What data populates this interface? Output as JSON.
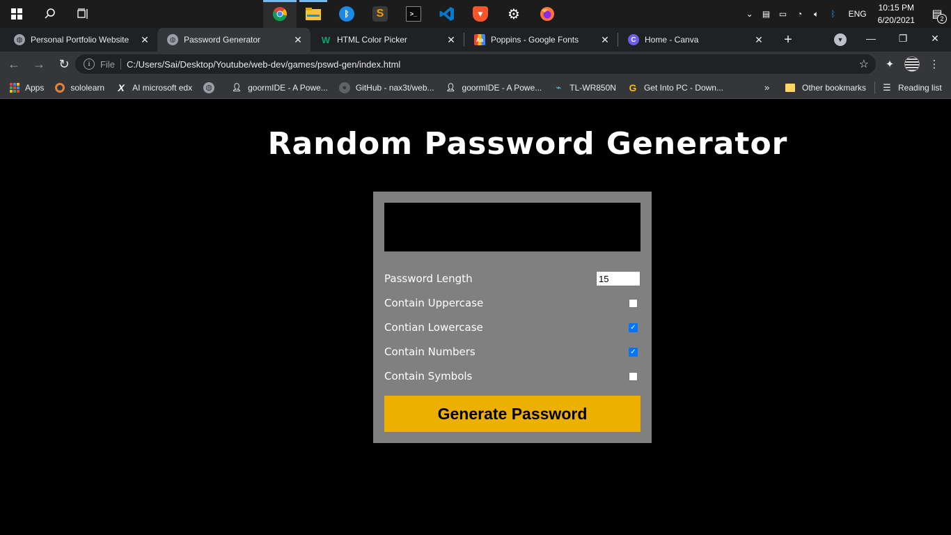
{
  "taskbar": {
    "apps": [
      {
        "name": "chrome-icon",
        "color": "#4285f4",
        "state": "active"
      },
      {
        "name": "file-explorer-icon",
        "color": "#f5c242",
        "state": "open"
      },
      {
        "name": "bluetooth-icon",
        "color": "#1e88e5",
        "state": "none"
      },
      {
        "name": "sublime-text-icon",
        "color": "#ff9800",
        "state": "none"
      },
      {
        "name": "terminal-icon",
        "color": "#333333",
        "state": "none"
      },
      {
        "name": "vscode-icon",
        "color": "#007acc",
        "state": "none"
      },
      {
        "name": "brave-icon",
        "color": "#fb542b",
        "state": "none"
      },
      {
        "name": "settings-icon",
        "color": "#ffffff",
        "state": "none"
      },
      {
        "name": "firefox-icon",
        "color": "#ff7139",
        "state": "none"
      }
    ],
    "language": "ENG",
    "time": "10:15 PM",
    "date": "6/20/2021",
    "notification_count": "2"
  },
  "tabs": [
    {
      "title": "Personal Portfolio Website",
      "active": false
    },
    {
      "title": "Password Generator",
      "active": true
    },
    {
      "title": "HTML Color Picker",
      "active": false
    },
    {
      "title": "Poppins - Google Fonts",
      "active": false
    },
    {
      "title": "Home - Canva",
      "active": false
    }
  ],
  "address_bar": {
    "scheme_label": "File",
    "url": "C:/Users/Sai/Desktop/Youtube/web-dev/games/pswd-gen/index.html"
  },
  "bookmarks": {
    "items": [
      {
        "label": "Apps"
      },
      {
        "label": "sololearn"
      },
      {
        "label": "AI microsoft edx"
      },
      {
        "label": ""
      },
      {
        "label": "goormIDE - A Powe..."
      },
      {
        "label": "GitHub - nax3t/web..."
      },
      {
        "label": "goormIDE - A Powe..."
      },
      {
        "label": "TL-WR850N"
      },
      {
        "label": "Get Into PC - Down..."
      }
    ],
    "more": "»",
    "other": "Other bookmarks",
    "reading_list": "Reading list"
  },
  "page": {
    "title": "Random Password Generator",
    "result": "",
    "settings": [
      {
        "label": "Password Length",
        "type": "number",
        "value": "15"
      },
      {
        "label": "Contain Uppercase",
        "type": "checkbox",
        "checked": false
      },
      {
        "label": "Contian Lowercase",
        "type": "checkbox",
        "checked": true
      },
      {
        "label": "Contain Numbers",
        "type": "checkbox",
        "checked": true
      },
      {
        "label": "Contain Symbols",
        "type": "checkbox",
        "checked": false
      }
    ],
    "generate_button": "Generate Password",
    "colors": {
      "card": "#808080",
      "button": "#ecb100",
      "background": "#000000"
    }
  }
}
